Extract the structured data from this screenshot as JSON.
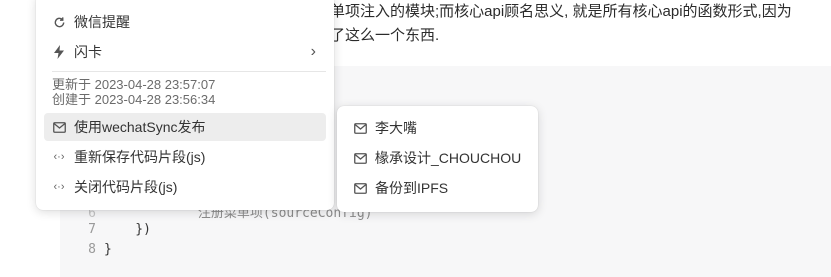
{
  "document": {
    "line1": "单项注入的模块;而核心api顾名思义, 就是所有核心api的函数形式,因为",
    "line2": "了这么一个东西."
  },
  "code": {
    "lines": [
      {
        "num": "6",
        "text": "            注册菜单项(sourceConfig)"
      },
      {
        "num": "7",
        "text": "    })"
      },
      {
        "num": "8",
        "text": "}"
      }
    ]
  },
  "menu": {
    "items": [
      {
        "label": "微信提醒",
        "icon": "refresh-icon"
      },
      {
        "label": "闪卡",
        "icon": "lightning-icon",
        "has_submenu": true
      }
    ],
    "updated": "更新于 2023-04-28 23:57:07",
    "created": "创建于 2023-04-28 23:56:34",
    "actions": [
      {
        "label": "使用wechatSync发布",
        "icon": "mail-icon",
        "active": true
      },
      {
        "label": "重新保存代码片段(js)",
        "icon": "code-icon"
      },
      {
        "label": "关闭代码片段(js)",
        "icon": "code-icon"
      }
    ]
  },
  "submenu": {
    "items": [
      {
        "label": "李大嘴",
        "icon": "mail-icon"
      },
      {
        "label": "椽承设计_CHOUCHOU",
        "icon": "mail-icon"
      },
      {
        "label": "备份到IPFS",
        "icon": "mail-icon"
      }
    ]
  },
  "colors": {
    "active_bg": "#ededed",
    "code_bg": "#f7f7f8"
  }
}
